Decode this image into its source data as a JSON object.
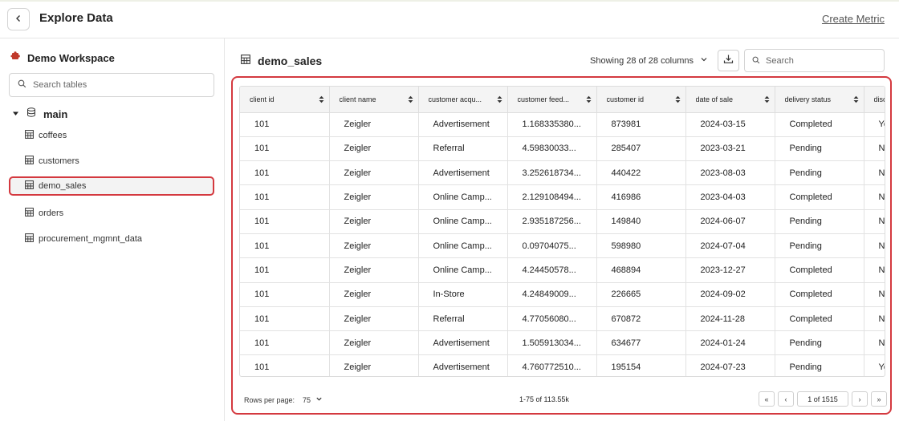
{
  "header": {
    "title": "Explore Data",
    "create_metric_label": "Create Metric"
  },
  "sidebar": {
    "workspace_name": "Demo Workspace",
    "search_placeholder": "Search tables",
    "group_label": "main",
    "items": [
      {
        "label": "coffees"
      },
      {
        "label": "customers"
      },
      {
        "label": "demo_sales"
      },
      {
        "label": "orders"
      },
      {
        "label": "procurement_mgmnt_data"
      }
    ],
    "selected_item": "demo_sales"
  },
  "main": {
    "table_name": "demo_sales",
    "showing_label": "Showing 28 of 28 columns",
    "search_placeholder": "Search",
    "columns": [
      "client id",
      "client name",
      "customer acqu...",
      "customer feed...",
      "customer id",
      "date of sale",
      "delivery status",
      "disc"
    ],
    "rows": [
      [
        "101",
        "Zeigler",
        "Advertisement",
        "1.168335380...",
        "873981",
        "2024-03-15",
        "Completed",
        "Ye"
      ],
      [
        "101",
        "Zeigler",
        "Referral",
        "4.59830033...",
        "285407",
        "2023-03-21",
        "Pending",
        "No"
      ],
      [
        "101",
        "Zeigler",
        "Advertisement",
        "3.252618734...",
        "440422",
        "2023-08-03",
        "Pending",
        "No"
      ],
      [
        "101",
        "Zeigler",
        "Online Camp...",
        "2.129108494...",
        "416986",
        "2023-04-03",
        "Completed",
        "No"
      ],
      [
        "101",
        "Zeigler",
        "Online Camp...",
        "2.935187256...",
        "149840",
        "2024-06-07",
        "Pending",
        "No"
      ],
      [
        "101",
        "Zeigler",
        "Online Camp...",
        "0.09704075...",
        "598980",
        "2024-07-04",
        "Pending",
        "No"
      ],
      [
        "101",
        "Zeigler",
        "Online Camp...",
        "4.24450578...",
        "468894",
        "2023-12-27",
        "Completed",
        "No"
      ],
      [
        "101",
        "Zeigler",
        "In-Store",
        "4.24849009...",
        "226665",
        "2024-09-02",
        "Completed",
        "No"
      ],
      [
        "101",
        "Zeigler",
        "Referral",
        "4.77056080...",
        "670872",
        "2024-11-28",
        "Completed",
        "No"
      ],
      [
        "101",
        "Zeigler",
        "Advertisement",
        "1.505913034...",
        "634677",
        "2024-01-24",
        "Pending",
        "No"
      ],
      [
        "101",
        "Zeigler",
        "Advertisement",
        "4.760772510...",
        "195154",
        "2024-07-23",
        "Pending",
        "Ye"
      ]
    ],
    "footer": {
      "rows_per_page_label": "Rows per page:",
      "rows_per_page_value": "75",
      "range_label": "1-75 of 113.55k",
      "page_label": "1 of 1515"
    }
  },
  "colors": {
    "highlight": "#d4393f",
    "workspace_icon": "#c0392b"
  },
  "icons": {
    "back": "chevron-left-icon",
    "workspace": "puzzle-icon",
    "search": "search-icon",
    "database": "database-icon",
    "table": "table-icon",
    "download": "download-icon",
    "sort": "sort-icon"
  }
}
